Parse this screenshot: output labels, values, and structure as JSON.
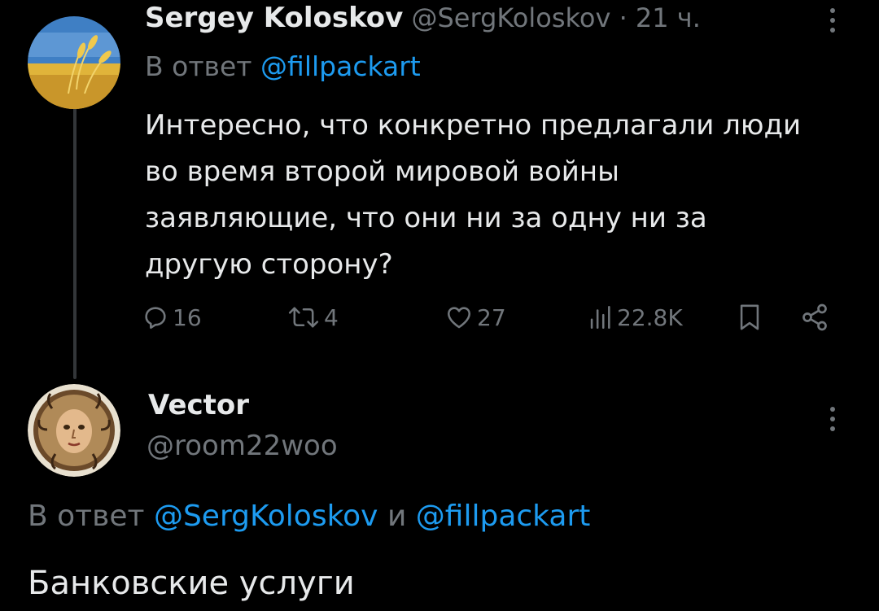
{
  "tweet1": {
    "author_name": "Sergey Koloskov",
    "handle": "@SergKoloskov",
    "separator": "·",
    "time": "21 ч.",
    "reply_prefix": "В ответ",
    "reply_to": "@fillpackart",
    "text_lines": [
      "Интересно, что конкретно предлагали люди",
      "во время второй мировой войны",
      "заявляющие, что они ни за одну ни за",
      "другую сторону?"
    ],
    "stats": {
      "replies": "16",
      "reposts": "4",
      "likes": "27",
      "views": "22.8K"
    },
    "avatar_icon": "wheat-field-avatar"
  },
  "tweet2": {
    "author_name": "Vector",
    "handle": "@room22woo",
    "reply_prefix": "В ответ",
    "reply_to_1": "@SergKoloskov",
    "reply_joiner": "и",
    "reply_to_2": "@fillpackart",
    "text": "Банковские услуги",
    "avatar_icon": "medusa-mosaic-avatar"
  },
  "colors": {
    "background": "#000000",
    "text": "#e7e9ea",
    "muted": "#71767b",
    "link": "#1d9bf0"
  }
}
